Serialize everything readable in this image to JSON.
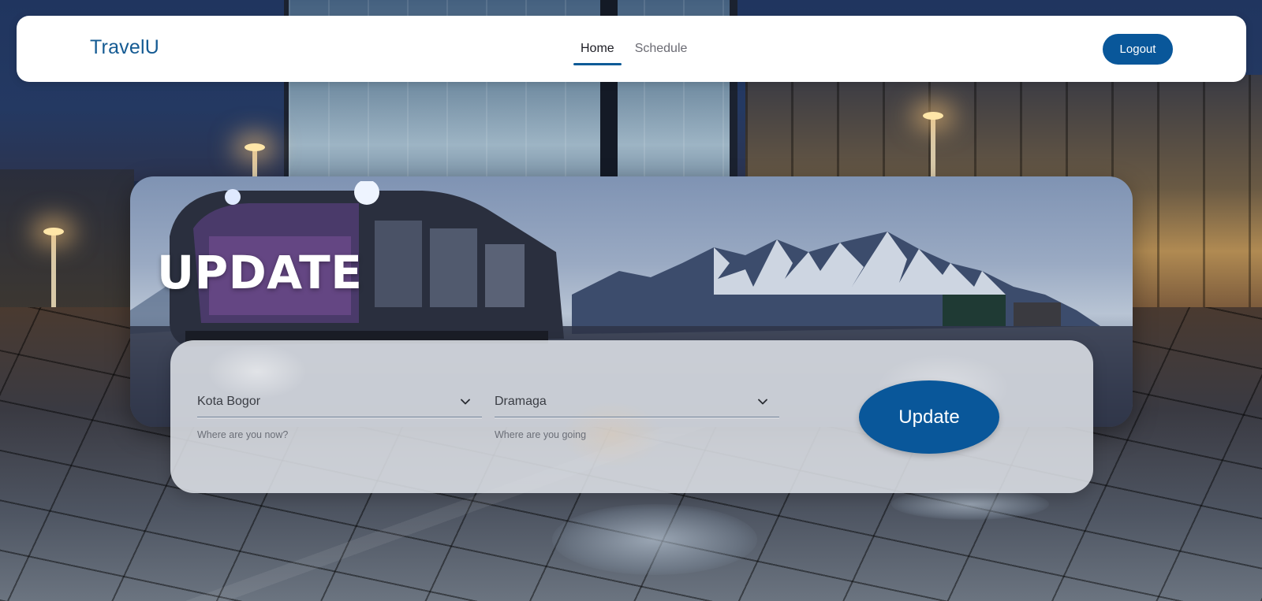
{
  "navbar": {
    "brand": "TravelU",
    "links": [
      {
        "label": "Home",
        "active": true
      },
      {
        "label": "Schedule",
        "active": false
      }
    ],
    "logout_label": "Logout"
  },
  "hero": {
    "title": "UPDATE"
  },
  "form": {
    "origin": {
      "value": "Kota Bogor",
      "helper": "Where are you now?",
      "icon": "chevron-down-icon"
    },
    "destination": {
      "value": "Dramaga",
      "helper": "Where are you going",
      "icon": "chevron-down-icon"
    },
    "submit_label": "Update"
  },
  "colors": {
    "brand": "#155b93",
    "button": "#09579a",
    "nav_active_underline": "#0d5b97"
  }
}
